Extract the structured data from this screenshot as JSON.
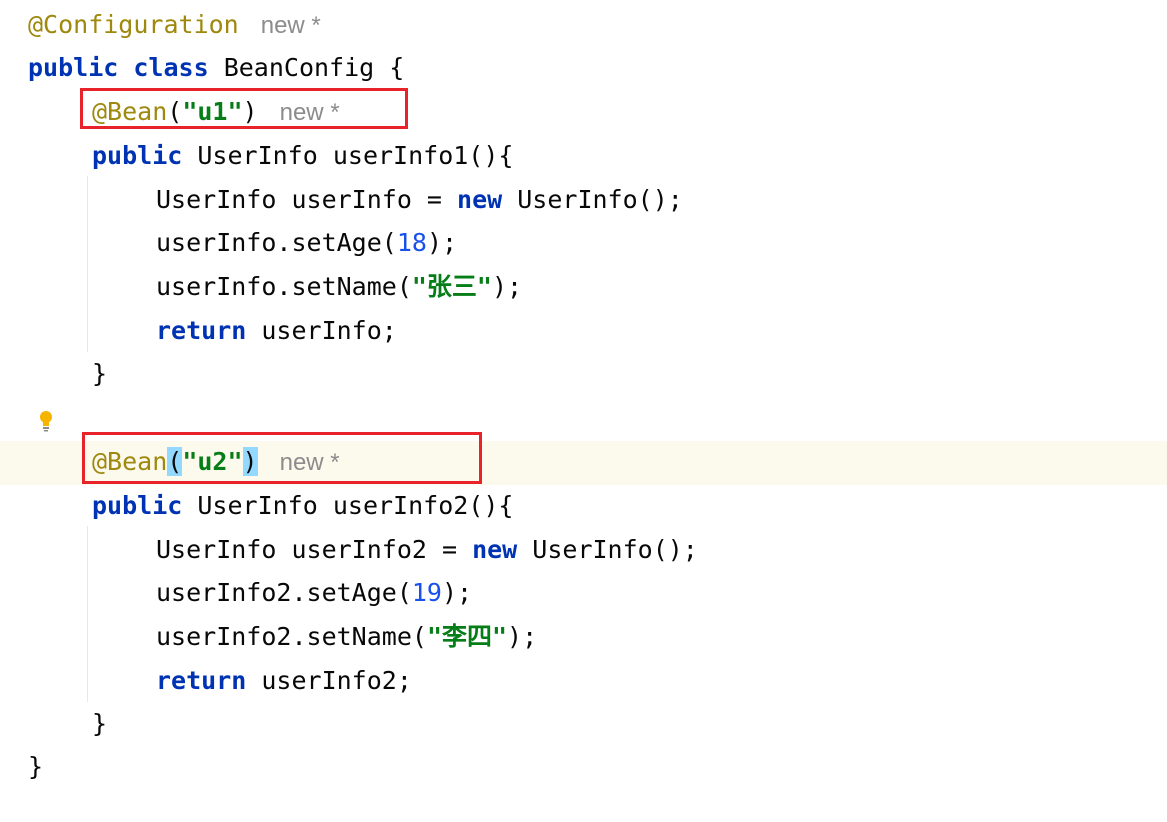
{
  "code": {
    "line1": {
      "annotation": "@Configuration",
      "hint": "new *"
    },
    "line2": {
      "kw1": "public",
      "kw2": "class",
      "name": "BeanConfig {"
    },
    "line3": {
      "annotation": "@Bean",
      "open": "(",
      "str": "\"u1\"",
      "close": ")",
      "hint": "new *"
    },
    "line4": {
      "kw": "public",
      "rest": "UserInfo userInfo1(){"
    },
    "line5": {
      "pre": "UserInfo userInfo = ",
      "kw": "new",
      "post": "UserInfo();"
    },
    "line6": {
      "pre": "userInfo.setAge(",
      "num": "18",
      "post": ");"
    },
    "line7": {
      "pre": "userInfo.setName(",
      "str": "\"张三\"",
      "post": ");"
    },
    "line8": {
      "kw": "return",
      "rest": "userInfo;"
    },
    "line9": {
      "text": "}"
    },
    "line11": {
      "annotation": "@Bean",
      "open": "(",
      "str": "\"u2\"",
      "close": ")",
      "hint": "new *"
    },
    "line12": {
      "kw": "public",
      "rest": "UserInfo userInfo2(){"
    },
    "line13": {
      "pre": "UserInfo userInfo2 = ",
      "kw": "new",
      "post": "UserInfo();"
    },
    "line14": {
      "pre": "userInfo2.setAge(",
      "num": "19",
      "post": ");"
    },
    "line15": {
      "pre": "userInfo2.setName(",
      "str": "\"李四\"",
      "post": ");"
    },
    "line16": {
      "kw": "return",
      "rest": "userInfo2;"
    },
    "line17": {
      "text": "}"
    },
    "line18": {
      "text": "}"
    }
  },
  "colors": {
    "keyword": "#0033b3",
    "annotation": "#9e880d",
    "string": "#067d17",
    "number": "#1750eb",
    "hint": "#8c8c8c",
    "highlight_box": "#e8232a",
    "caret_line": "#fcfaed"
  },
  "icons": {
    "intention": "lightbulb-icon"
  }
}
